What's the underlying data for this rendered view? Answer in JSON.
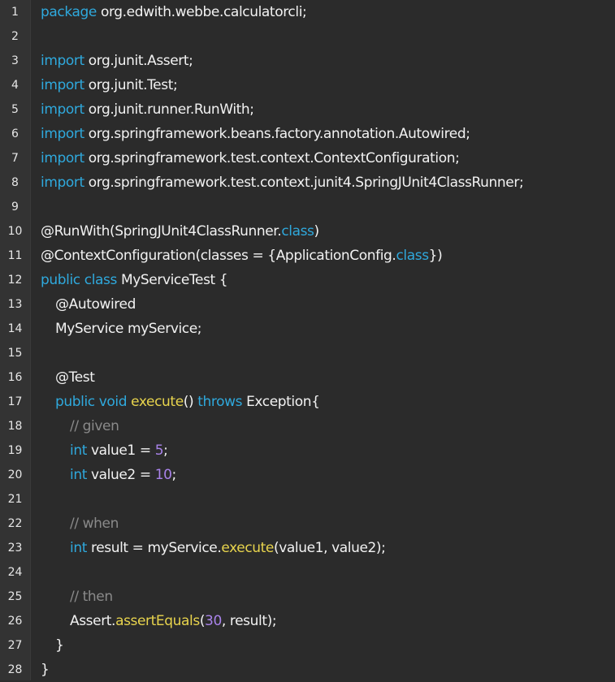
{
  "gutter": {
    "line_numbers": [
      "1",
      "2",
      "3",
      "4",
      "5",
      "6",
      "7",
      "8",
      "9",
      "10",
      "11",
      "12",
      "13",
      "14",
      "15",
      "16",
      "17",
      "18",
      "19",
      "20",
      "21",
      "22",
      "23",
      "24",
      "25",
      "26",
      "27",
      "28"
    ]
  },
  "colors": {
    "background": "#2b2b2b",
    "gutter_bg": "#333333",
    "keyword": "#2fa9dd",
    "method": "#e8d44d",
    "number": "#a983ea",
    "comment": "#8a8a8a",
    "text": "#f2f2f2"
  },
  "code": {
    "lines": [
      {
        "indent": 0,
        "tokens": [
          {
            "t": "kw",
            "v": "package"
          },
          {
            "t": "tx",
            "v": " org.edwith.webbe.calculatorcli;"
          }
        ]
      },
      {
        "indent": 0,
        "tokens": []
      },
      {
        "indent": 0,
        "tokens": [
          {
            "t": "kw",
            "v": "import"
          },
          {
            "t": "tx",
            "v": " org.junit.Assert;"
          }
        ]
      },
      {
        "indent": 0,
        "tokens": [
          {
            "t": "kw",
            "v": "import"
          },
          {
            "t": "tx",
            "v": " org.junit.Test;"
          }
        ]
      },
      {
        "indent": 0,
        "tokens": [
          {
            "t": "kw",
            "v": "import"
          },
          {
            "t": "tx",
            "v": " org.junit.runner.RunWith;"
          }
        ]
      },
      {
        "indent": 0,
        "tokens": [
          {
            "t": "kw",
            "v": "import"
          },
          {
            "t": "tx",
            "v": " org.springframework.beans.factory.annotation.Autowired;"
          }
        ]
      },
      {
        "indent": 0,
        "tokens": [
          {
            "t": "kw",
            "v": "import"
          },
          {
            "t": "tx",
            "v": " org.springframework.test.context.ContextConfiguration;"
          }
        ]
      },
      {
        "indent": 0,
        "tokens": [
          {
            "t": "kw",
            "v": "import"
          },
          {
            "t": "tx",
            "v": " org.springframework.test.context.junit4.SpringJUnit4ClassRunner;"
          }
        ]
      },
      {
        "indent": 0,
        "tokens": []
      },
      {
        "indent": 0,
        "tokens": [
          {
            "t": "tx",
            "v": "@RunWith(SpringJUnit4ClassRunner."
          },
          {
            "t": "kw",
            "v": "class"
          },
          {
            "t": "tx",
            "v": ")"
          }
        ]
      },
      {
        "indent": 0,
        "tokens": [
          {
            "t": "tx",
            "v": "@ContextConfiguration(classes = {ApplicationConfig."
          },
          {
            "t": "kw",
            "v": "class"
          },
          {
            "t": "tx",
            "v": "})"
          }
        ]
      },
      {
        "indent": 0,
        "tokens": [
          {
            "t": "kw",
            "v": "public class"
          },
          {
            "t": "tx",
            "v": " MyServiceTest {"
          }
        ]
      },
      {
        "indent": 1,
        "tokens": [
          {
            "t": "tx",
            "v": "@Autowired"
          }
        ]
      },
      {
        "indent": 1,
        "tokens": [
          {
            "t": "tx",
            "v": "MyService myService;"
          }
        ]
      },
      {
        "indent": 0,
        "tokens": []
      },
      {
        "indent": 1,
        "tokens": [
          {
            "t": "tx",
            "v": "@Test"
          }
        ]
      },
      {
        "indent": 1,
        "tokens": [
          {
            "t": "kw",
            "v": "public void"
          },
          {
            "t": "tx",
            "v": " "
          },
          {
            "t": "fn",
            "v": "execute"
          },
          {
            "t": "tx",
            "v": "() "
          },
          {
            "t": "kw",
            "v": "throws"
          },
          {
            "t": "tx",
            "v": " Exception{"
          }
        ]
      },
      {
        "indent": 2,
        "tokens": [
          {
            "t": "cm",
            "v": "// given"
          }
        ]
      },
      {
        "indent": 2,
        "tokens": [
          {
            "t": "kw",
            "v": "int"
          },
          {
            "t": "tx",
            "v": " value1 = "
          },
          {
            "t": "num",
            "v": "5"
          },
          {
            "t": "tx",
            "v": ";"
          }
        ]
      },
      {
        "indent": 2,
        "tokens": [
          {
            "t": "kw",
            "v": "int"
          },
          {
            "t": "tx",
            "v": " value2 = "
          },
          {
            "t": "num",
            "v": "10"
          },
          {
            "t": "tx",
            "v": ";"
          }
        ]
      },
      {
        "indent": 0,
        "tokens": []
      },
      {
        "indent": 2,
        "tokens": [
          {
            "t": "cm",
            "v": "// when"
          }
        ]
      },
      {
        "indent": 2,
        "tokens": [
          {
            "t": "kw",
            "v": "int"
          },
          {
            "t": "tx",
            "v": " result = myService."
          },
          {
            "t": "fn",
            "v": "execute"
          },
          {
            "t": "tx",
            "v": "(value1, value2);"
          }
        ]
      },
      {
        "indent": 0,
        "tokens": []
      },
      {
        "indent": 2,
        "tokens": [
          {
            "t": "cm",
            "v": "// then"
          }
        ]
      },
      {
        "indent": 2,
        "tokens": [
          {
            "t": "tx",
            "v": "Assert."
          },
          {
            "t": "fn",
            "v": "assertEquals"
          },
          {
            "t": "tx",
            "v": "("
          },
          {
            "t": "num",
            "v": "30"
          },
          {
            "t": "tx",
            "v": ", result);"
          }
        ]
      },
      {
        "indent": 1,
        "tokens": [
          {
            "t": "tx",
            "v": "}"
          }
        ]
      },
      {
        "indent": 0,
        "tokens": [
          {
            "t": "tx",
            "v": "}"
          }
        ]
      }
    ]
  }
}
